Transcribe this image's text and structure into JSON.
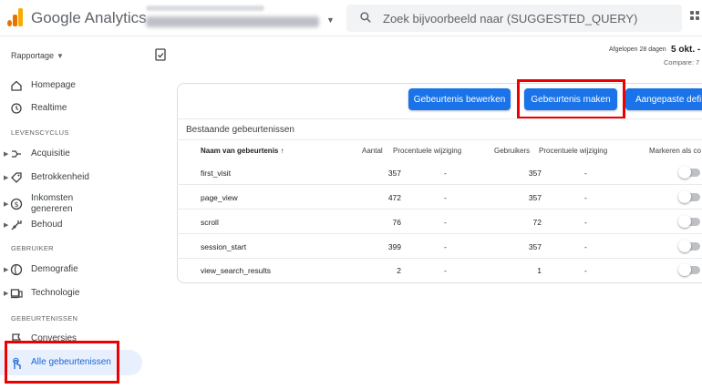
{
  "header": {
    "brand": "Google Analytics",
    "search_placeholder": "Zoek bijvoorbeeld naar (SUGGESTED_QUERY)"
  },
  "sidebar": {
    "reports_label": "Rapportage",
    "items_top": [
      {
        "label": "Homepage",
        "icon": "home-icon"
      },
      {
        "label": "Realtime",
        "icon": "clock-icon"
      }
    ],
    "section_lifecycle": "LEVENSCYCLUS",
    "items_lifecycle": [
      {
        "label": "Acquisitie",
        "icon": "acquisition-icon"
      },
      {
        "label": "Betrokkenheid",
        "icon": "engagement-icon"
      },
      {
        "label": "Inkomsten genereren",
        "icon": "monetization-icon"
      },
      {
        "label": "Behoud",
        "icon": "retention-icon"
      }
    ],
    "section_user": "GEBRUIKER",
    "items_user": [
      {
        "label": "Demografie",
        "icon": "globe-icon"
      },
      {
        "label": "Technologie",
        "icon": "devices-icon"
      }
    ],
    "section_events": "GEBEURTENISSEN",
    "items_events": [
      {
        "label": "Conversies",
        "icon": "flag-icon"
      },
      {
        "label": "Alle gebeurtenissen",
        "icon": "touch-icon"
      }
    ]
  },
  "date": {
    "range_label": "Afgelopen 28 dagen",
    "range_value": "5 okt. -",
    "compare": "Compare: 7"
  },
  "toolbar": {
    "edit_label": "Gebeurtenis bewerken",
    "create_label": "Gebeurtenis maken",
    "custom_label": "Aangepaste defin"
  },
  "table": {
    "title": "Bestaande gebeurtenissen",
    "columns": {
      "name": "Naam van gebeurtenis",
      "count": "Aantal",
      "count_change": "Procentuele wijziging",
      "users": "Gebruikers",
      "users_change": "Procentuele wijziging",
      "conversion": "Markeren als co"
    },
    "rows": [
      {
        "name": "first_visit",
        "count": "357",
        "count_change": "-",
        "users": "357",
        "users_change": "-"
      },
      {
        "name": "page_view",
        "count": "472",
        "count_change": "-",
        "users": "357",
        "users_change": "-"
      },
      {
        "name": "scroll",
        "count": "76",
        "count_change": "-",
        "users": "72",
        "users_change": "-"
      },
      {
        "name": "session_start",
        "count": "399",
        "count_change": "-",
        "users": "357",
        "users_change": "-"
      },
      {
        "name": "view_search_results",
        "count": "2",
        "count_change": "-",
        "users": "1",
        "users_change": "-"
      }
    ]
  },
  "colors": {
    "accent": "#1a73e8",
    "highlight_box": "#ee0000",
    "active_nav_bg": "#e8f0fe"
  }
}
